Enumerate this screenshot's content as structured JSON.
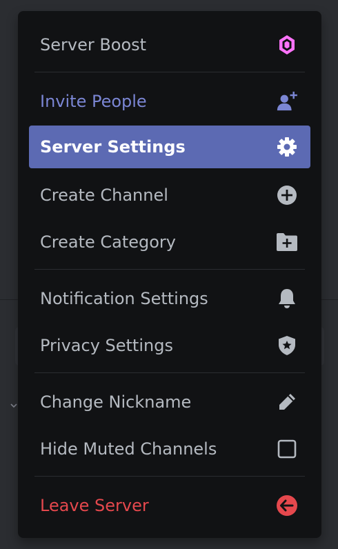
{
  "menu": {
    "items": [
      {
        "label": "Server Boost",
        "icon": "boost-gem-icon"
      },
      {
        "label": "Invite People",
        "icon": "add-person-icon"
      },
      {
        "label": "Server Settings",
        "icon": "gear-icon"
      },
      {
        "label": "Create Channel",
        "icon": "plus-circle-icon"
      },
      {
        "label": "Create Category",
        "icon": "folder-plus-icon"
      },
      {
        "label": "Notification Settings",
        "icon": "bell-icon"
      },
      {
        "label": "Privacy Settings",
        "icon": "shield-star-icon"
      },
      {
        "label": "Change Nickname",
        "icon": "pencil-icon"
      },
      {
        "label": "Hide Muted Channels",
        "icon": "checkbox-unchecked-icon"
      },
      {
        "label": "Leave Server",
        "icon": "leave-arrow-icon"
      }
    ],
    "selected_index": 2,
    "hide_muted_checked": false
  },
  "colors": {
    "menu_bg": "#111214",
    "page_bg": "#2b2d31",
    "text_default": "#b5bac1",
    "invite_accent": "#7b86d4",
    "selected_bg": "#5c6ab3",
    "danger": "#e5484d",
    "boost_pink": "#ff73fa"
  }
}
